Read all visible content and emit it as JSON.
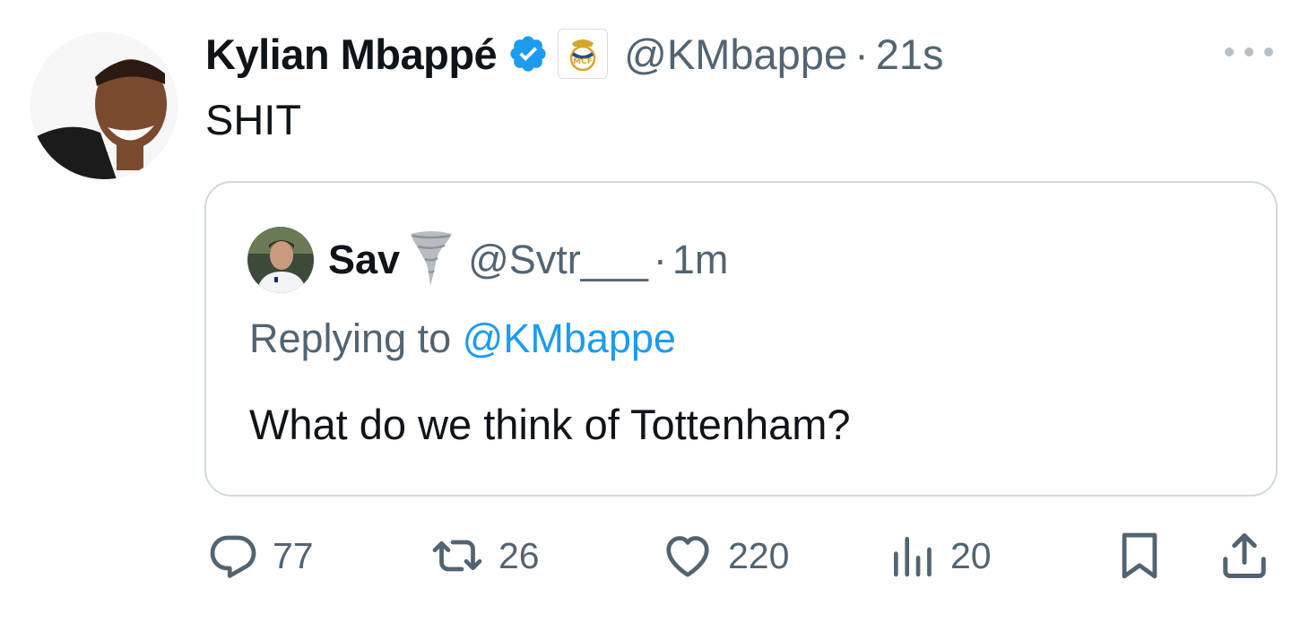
{
  "tweet": {
    "display_name": "Kylian Mbappé",
    "handle": "@KMbappe",
    "separator": "·",
    "time": "21s",
    "text": "SHIT",
    "verified_badge": "verified-badge-icon",
    "affiliation_badge": "real-madrid-crest-icon",
    "accent_color": "#1d9bf0"
  },
  "quote": {
    "display_name": "Sav",
    "emoji": "tornado-icon",
    "handle": "@Svtr___",
    "separator": "·",
    "time": "1m",
    "replying_prefix": "Replying to ",
    "replying_mention": "@KMbappe",
    "text": "What do we think of Tottenham?"
  },
  "actions": {
    "replies": "77",
    "reposts": "26",
    "likes": "220",
    "views": "20"
  }
}
